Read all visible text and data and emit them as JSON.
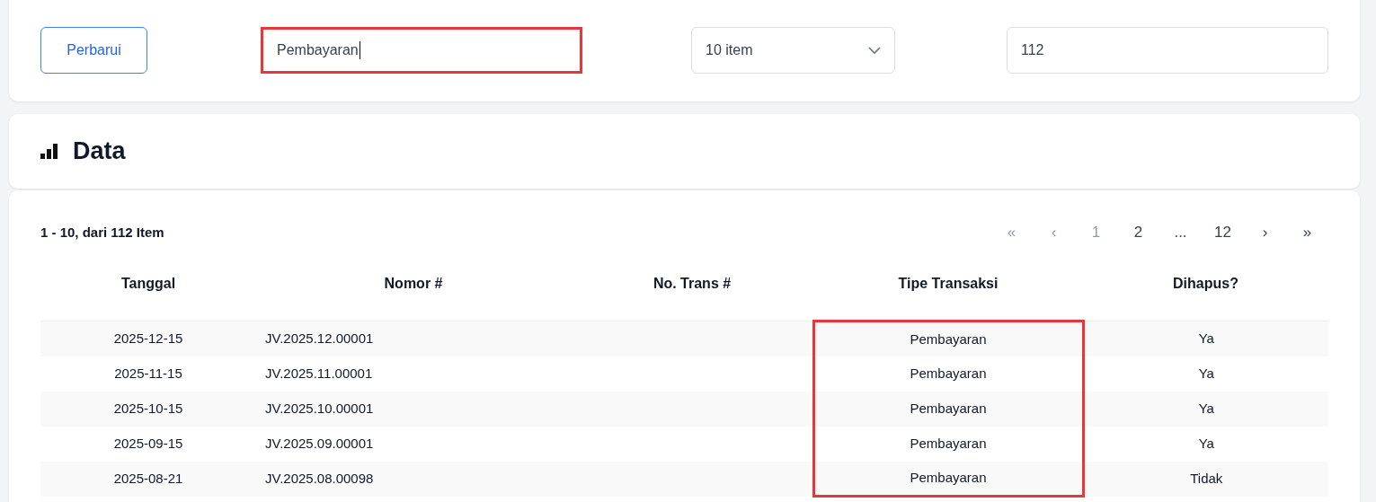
{
  "filter_bar": {
    "refresh_button": "Perbarui",
    "search": {
      "value": "Pembayaran",
      "highlighted": true
    },
    "page_size": "10 item",
    "total_field": {
      "value": "112"
    }
  },
  "data_card": {
    "title": "Data"
  },
  "summary": "1 - 10, dari 112 Item",
  "pagination": [
    {
      "label": "«",
      "disabled": true
    },
    {
      "label": "‹",
      "disabled": true
    },
    {
      "label": "1",
      "disabled": true
    },
    {
      "label": "2",
      "disabled": false
    },
    {
      "label": "...",
      "disabled": false
    },
    {
      "label": "12",
      "disabled": false
    },
    {
      "label": "›",
      "disabled": false
    },
    {
      "label": "»",
      "disabled": false
    }
  ],
  "table": {
    "columns": [
      {
        "label": "Tanggal",
        "highlighted": false
      },
      {
        "label": "Nomor #",
        "highlighted": false
      },
      {
        "label": "No. Trans #",
        "highlighted": false
      },
      {
        "label": "Tipe Transaksi",
        "highlighted": true
      },
      {
        "label": "Dihapus?",
        "highlighted": false
      }
    ],
    "rows": [
      [
        "2025-12-15",
        "JV.2025.12.00001",
        "",
        "Pembayaran",
        "Ya"
      ],
      [
        "2025-11-15",
        "JV.2025.11.00001",
        "",
        "Pembayaran",
        "Ya"
      ],
      [
        "2025-10-15",
        "JV.2025.10.00001",
        "",
        "Pembayaran",
        "Ya"
      ],
      [
        "2025-09-15",
        "JV.2025.09.00001",
        "",
        "Pembayaran",
        "Ya"
      ],
      [
        "2025-08-21",
        "JV.2025.08.00098",
        "",
        "Pembayaran",
        "Tidak"
      ]
    ]
  }
}
